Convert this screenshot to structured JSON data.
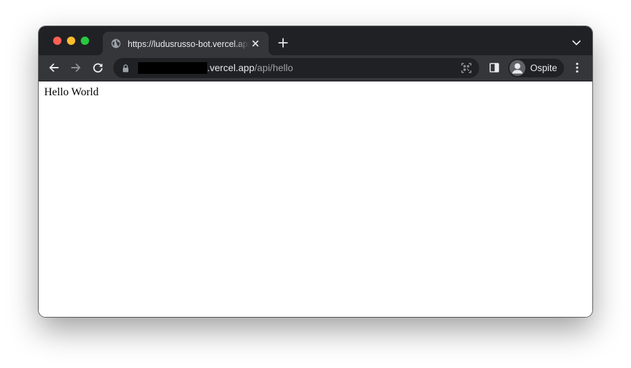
{
  "tabs": [
    {
      "title": "https://ludusrusso-bot.vercel.app/api/hello",
      "favicon": "globe-icon",
      "active": true
    }
  ],
  "address_bar": {
    "host": ".vercel.app",
    "path": "/api/hello",
    "redacted": true
  },
  "profile": {
    "label": "Ospite"
  },
  "page": {
    "text": "Hello World"
  },
  "colors": {
    "titlebar": "#202124",
    "toolbar": "#35363a",
    "omnibox": "#202124",
    "text_primary": "#e8eaed",
    "text_secondary": "#9aa0a6",
    "close_red": "#ff5f57",
    "minimize_yellow": "#febc2e",
    "zoom_green": "#28c840"
  },
  "icons": [
    "close-window-icon",
    "minimize-window-icon",
    "zoom-window-icon",
    "globe-icon",
    "tab-close-icon",
    "new-tab-icon",
    "tab-search-chevron-icon",
    "back-arrow-icon",
    "forward-arrow-icon",
    "reload-icon",
    "lock-icon",
    "qr-code-icon",
    "side-panel-icon",
    "profile-avatar-icon",
    "kebab-menu-icon"
  ]
}
